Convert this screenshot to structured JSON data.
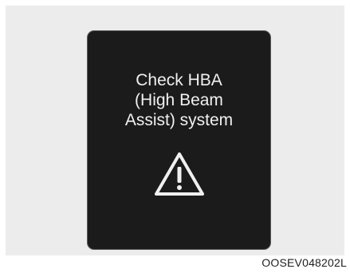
{
  "display": {
    "message_lines": [
      "Check HBA",
      "(High Beam",
      "Assist) system"
    ],
    "icon": "warning-triangle-icon"
  },
  "figure_code": "OOSEV048202L",
  "colors": {
    "page_background": "#ffffff",
    "frame_background": "#ececec",
    "display_background": "#1b1b1b",
    "display_text": "#f0f0f0"
  }
}
